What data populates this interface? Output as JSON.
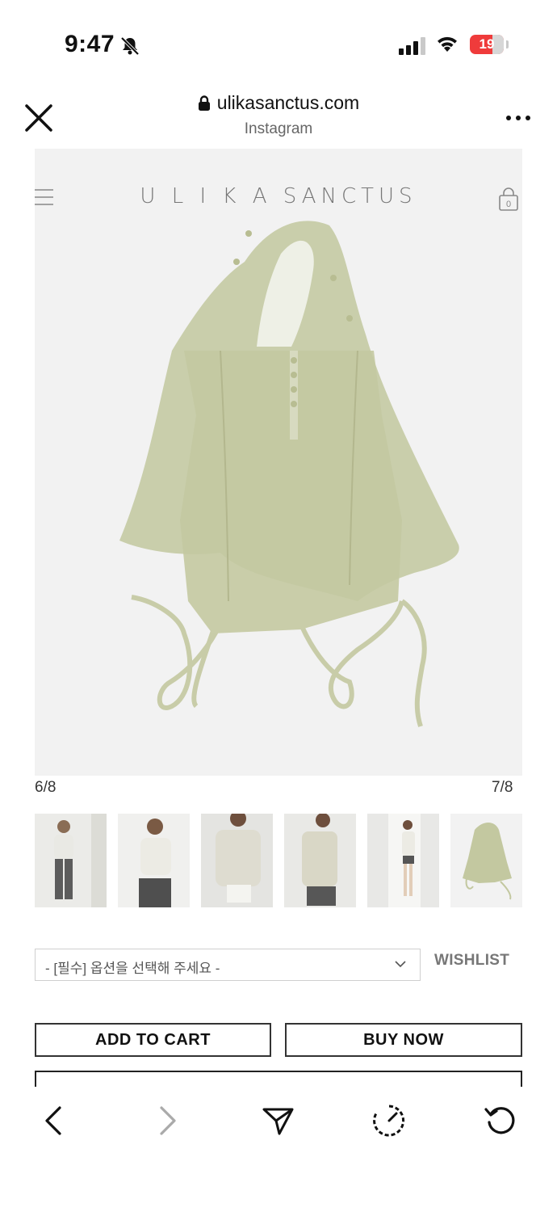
{
  "status_bar": {
    "time": "9:47",
    "battery_level": "19"
  },
  "browser": {
    "url": "ulikasanctus.com",
    "source_app": "Instagram"
  },
  "site": {
    "brand": "U L I K A SANCTUS",
    "cart_count": "0"
  },
  "gallery": {
    "current_left": "6/8",
    "current_right": "7/8",
    "thumbnails": [
      "model-front-grey-pants",
      "model-closeup-top",
      "model-front-shorts",
      "model-side-shorts",
      "model-full-body-doorway",
      "garment-flat-lay"
    ]
  },
  "product": {
    "option_placeholder": "- [필수] 옵션을 선택해 주세요 -",
    "wishlist_label": "WISHLIST",
    "add_to_cart_label": "ADD TO CART",
    "buy_now_label": "BUY NOW"
  },
  "colors": {
    "garment": "#c8cca8",
    "battery": "#ef3b3b"
  },
  "toolbar": {
    "icons": [
      "back-icon",
      "forward-icon",
      "share-icon",
      "speed-icon",
      "reload-icon"
    ]
  }
}
